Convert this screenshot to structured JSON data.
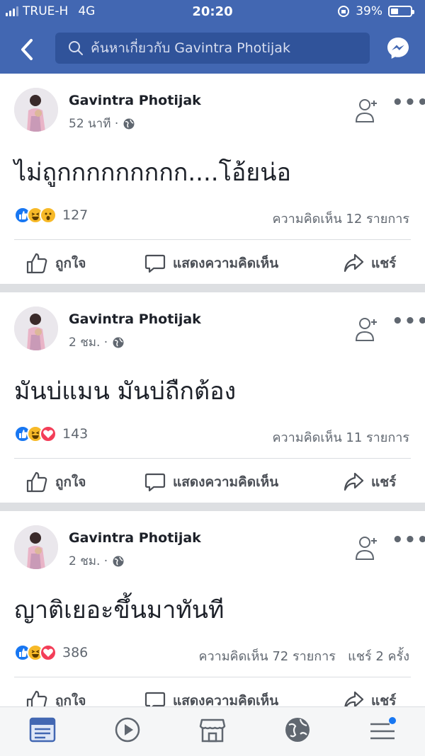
{
  "status_bar": {
    "carrier": "TRUE-H",
    "network": "4G",
    "time": "20:20",
    "battery": "39%",
    "battery_level": 0.39
  },
  "header": {
    "search_placeholder": "ค้นหาเกี่ยวกับ Gavintra Photijak",
    "icons": [
      "back-icon",
      "search-icon",
      "messenger-icon"
    ]
  },
  "posts": [
    {
      "author": "Gavintra Photijak",
      "time": "52 นาที ·",
      "text": "ไม่ถูกกกกกกกกก....โอ้ยน่อ",
      "reactions": [
        "like",
        "haha",
        "wow"
      ],
      "reaction_count": "127",
      "comments_summary": "ความคิดเห็น 12 รายการ"
    },
    {
      "author": "Gavintra Photijak",
      "time": "2 ชม. ·",
      "text": "มันบ่แมน มันบ่ถืกต้อง",
      "reactions": [
        "like",
        "haha",
        "love"
      ],
      "reaction_count": "143",
      "comments_summary": "ความคิดเห็น 11 รายการ"
    },
    {
      "author": "Gavintra Photijak",
      "time": "2 ชม. ·",
      "text": "ญาติเยอะขึ้นมาทันที",
      "reactions": [
        "like",
        "haha",
        "love"
      ],
      "reaction_count": "386",
      "comments_summary": "ความคิดเห็น 72 รายการ   แชร์ 2 ครั้ง"
    }
  ],
  "actions": {
    "like": "ถูกใจ",
    "comment": "แสดงความคิดเห็น",
    "share": "แชร์"
  },
  "bottom_nav": [
    "news-feed-icon",
    "watch-icon",
    "marketplace-icon",
    "globe-notifications-icon",
    "menu-icon"
  ],
  "colors": {
    "header": "#4267b2",
    "search_bg": "#30539a",
    "like": "#1877f2",
    "love": "#f33e58",
    "haha": "#f7b928",
    "text_secondary": "#606770"
  }
}
